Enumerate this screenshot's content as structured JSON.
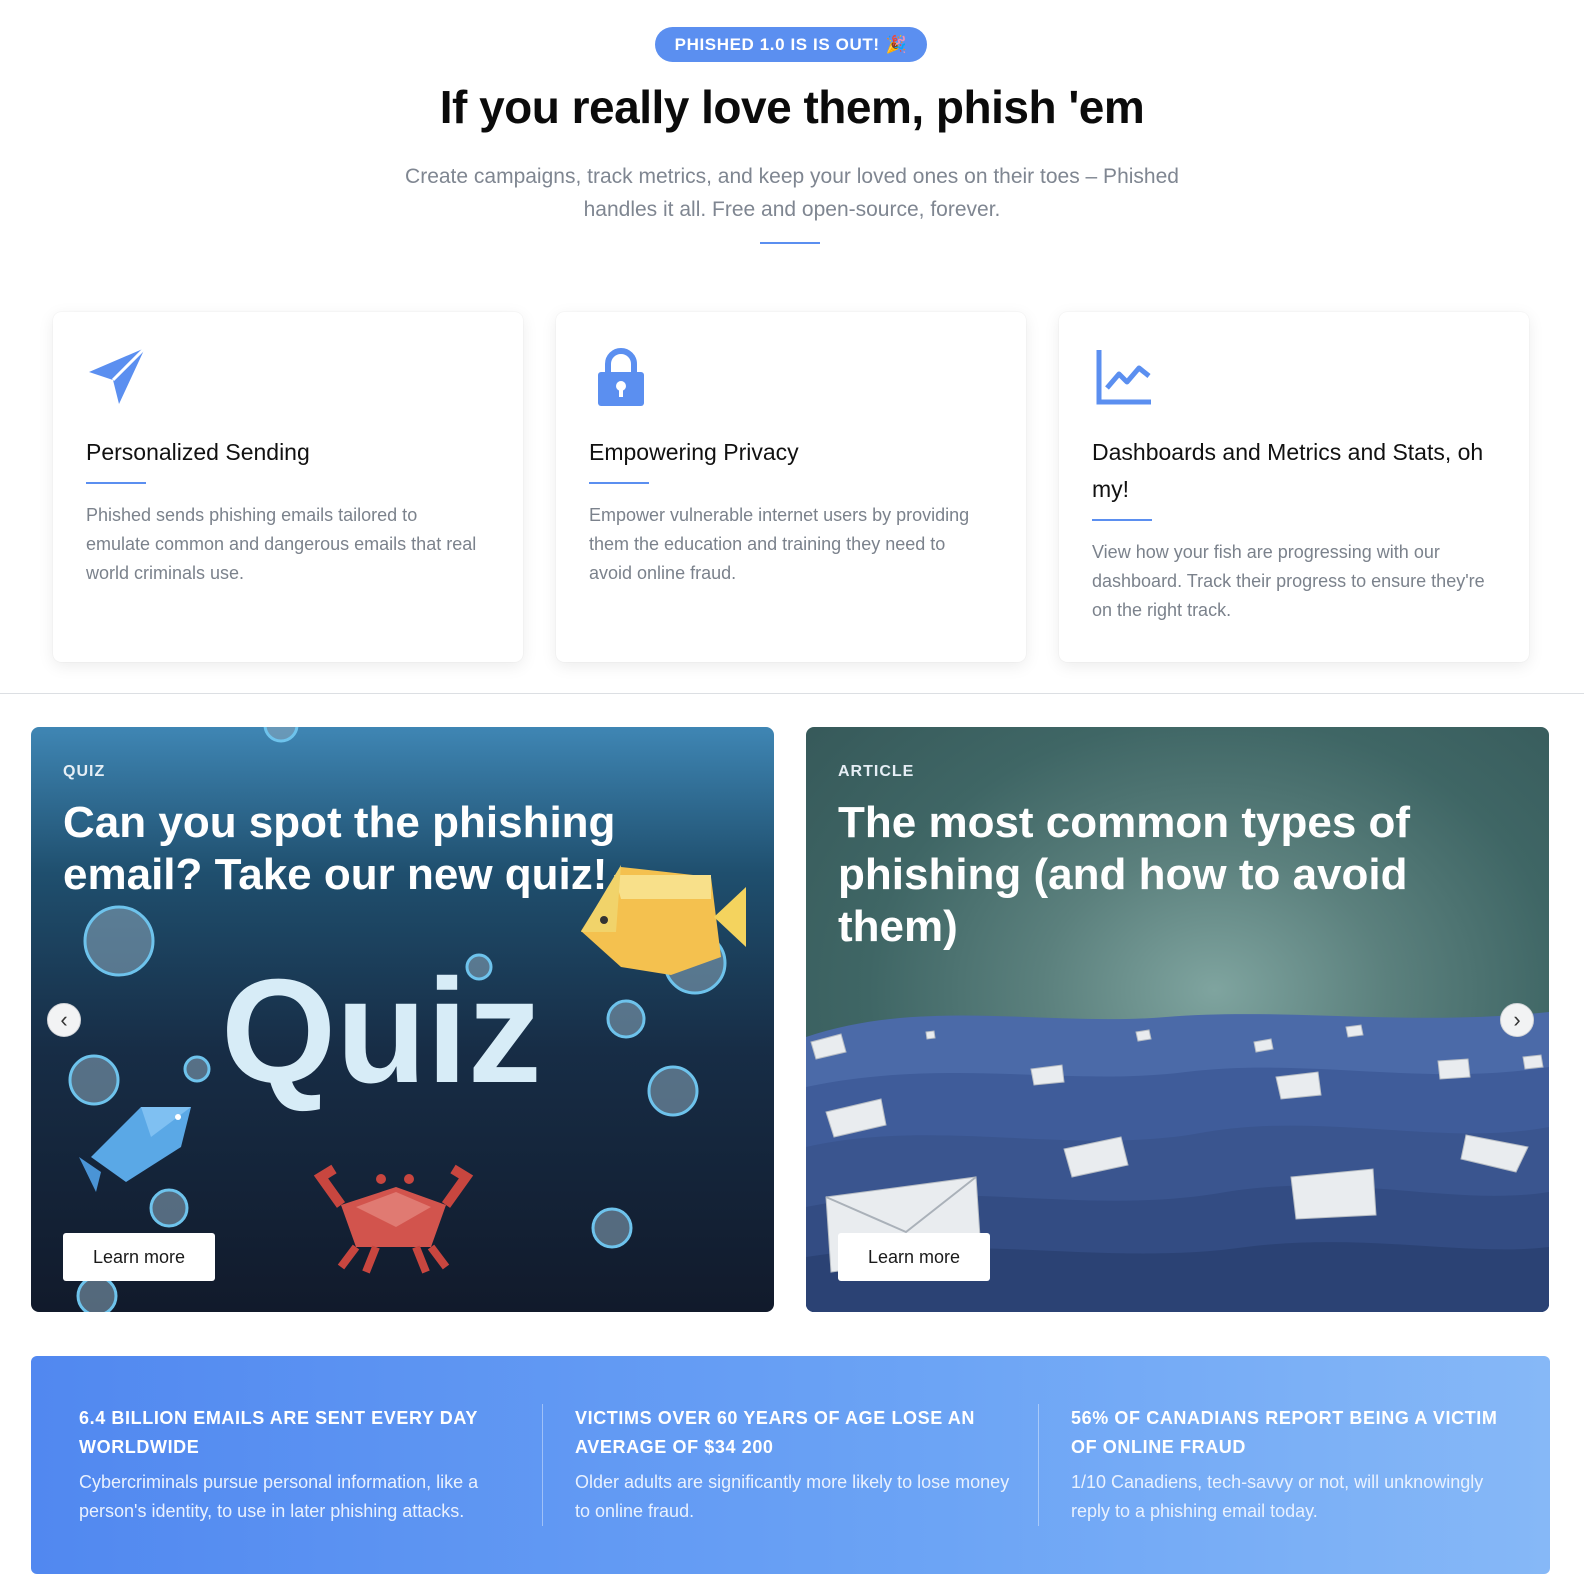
{
  "hero": {
    "badge": "PHISHED 1.0 IS IS OUT!",
    "badge_emoji": "🎉",
    "title": "If you really love them, phish 'em",
    "subtitle": "Create campaigns, track metrics, and keep your loved ones on their toes – Phished handles it all. Free and open-source, forever."
  },
  "features": [
    {
      "icon": "paper-plane-icon",
      "title": "Personalized Sending",
      "text": "Phished sends phishing emails tailored to emulate common and dangerous emails that real world criminals use."
    },
    {
      "icon": "lock-icon",
      "title": "Empowering Privacy",
      "text": "Empower vulnerable internet users by providing them the education and training they need to avoid online fraud."
    },
    {
      "icon": "line-chart-icon",
      "title": "Dashboards and Metrics and Stats, oh my!",
      "text": "View how your fish are progressing with our dashboard. Track their progress to ensure they're on the right track."
    }
  ],
  "promos": [
    {
      "kicker": "QUIZ",
      "title": "Can you spot the phishing email? Take our new quiz!",
      "art_text": "Quiz",
      "button": "Learn more"
    },
    {
      "kicker": "ARTICLE",
      "title": "The most common types of phishing (and how to avoid them)",
      "button": "Learn more"
    }
  ],
  "carousel": {
    "prev_icon": "‹",
    "next_icon": "›"
  },
  "stats": [
    {
      "heading": "6.4 BILLION EMAILS ARE SENT EVERY DAY WORLDWIDE",
      "text": "Cybercriminals pursue personal information, like a person's identity, to use in later phishing attacks."
    },
    {
      "heading": "VICTIMS OVER 60 YEARS OF AGE LOSE AN AVERAGE OF $34 200",
      "text": "Older adults are significantly more likely to lose money to online fraud."
    },
    {
      "heading": "56% OF CANADIANS REPORT BEING A VICTIM OF ONLINE FRAUD",
      "text": "1/10 Canadiens, tech-savvy or not, will unknowingly reply to a phishing email today."
    }
  ],
  "colors": {
    "accent": "#5b8ff0",
    "muted_text": "#7b828c"
  }
}
